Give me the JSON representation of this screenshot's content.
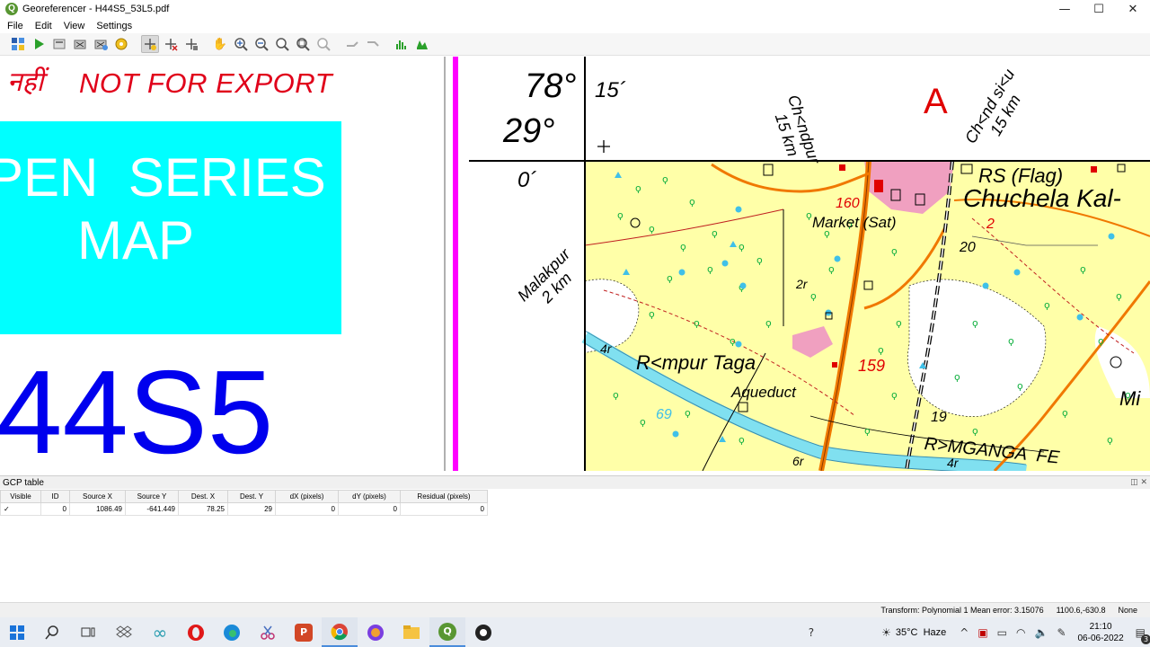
{
  "window": {
    "title": "Georeferencer - H44S5_53L5.pdf",
    "minimize_glyph": "—",
    "maximize_glyph": "☐",
    "close_glyph": "✕"
  },
  "menu": [
    "File",
    "Edit",
    "View",
    "Settings"
  ],
  "toolbar": {
    "icons": [
      "open-raster-icon",
      "start-georeferencing-icon",
      "generate-gdal-script-icon",
      "load-gcp-icon",
      "save-gcp-icon",
      "transformation-settings-icon",
      "add-point-icon",
      "delete-point-icon",
      "move-point-icon",
      "pan-icon",
      "zoom-in-icon",
      "zoom-out-icon",
      "zoom-to-layer-icon",
      "zoom-last-icon",
      "zoom-next-icon",
      "link-georef-to-qgis-icon",
      "link-qgis-to-georef-icon",
      "full-histogram-stretch-icon",
      "local-histogram-stretch-icon"
    ]
  },
  "left_canvas": {
    "hindi_text": "नहीं",
    "not_for_export": "NOT FOR EXPORT",
    "series_line1": "PEN  SERIES",
    "series_line2": "MAP",
    "sheet_number": "44S5",
    "colors": {
      "banner": "#00ffff",
      "red_text": "#e0001a",
      "sheet_blue": "#0000ee"
    }
  },
  "map": {
    "lon_deg": "78°",
    "lat_deg": "29°",
    "lon_min": "15´",
    "lat_min": "0´",
    "sheet_letter": "A",
    "to_chandpur": "Ch<ndpur",
    "chandpur_dist": "15 km",
    "to_chandsiau": "Ch<nd si<u",
    "chandsiau_dist": "15 km",
    "to_malakpur": "Malakpur",
    "malakpur_dist": "2 km",
    "rs_flag": "RS (Flag)",
    "chuchela": "Chuchela Kal-",
    "market": "Market (Sat)",
    "spot_160": "160",
    "spot_159": "159",
    "spot_2": "2",
    "spot_20": "20",
    "spot_19": "19",
    "spot_69": "69",
    "lbl_2r": "2r",
    "lbl_4r": "4r",
    "lbl_4r_b": "4r",
    "lbl_6r": "6r",
    "rampur": "R<mpur Taga",
    "aqueduct": "Aqueduct",
    "mganga": "R>MGANGA  FE",
    "mi": "Mi",
    "colors": {
      "land": "#ffffa8",
      "veg": "#10b040",
      "road": "#f07800",
      "canal": "#80e0f0",
      "village": "#f0a0c0",
      "grid": "#000000",
      "spot_red": "#e00000"
    }
  },
  "gcp": {
    "title": "GCP table",
    "dock_controls": "◫ ✕",
    "columns": [
      "Visible",
      "ID",
      "Source X",
      "Source Y",
      "Dest. X",
      "Dest. Y",
      "dX (pixels)",
      "dY (pixels)",
      "Residual (pixels)"
    ],
    "rows": [
      [
        "✓",
        "0",
        "1086.49",
        "-641.449",
        "78.25",
        "29",
        "0",
        "0",
        "0"
      ]
    ]
  },
  "status": {
    "transform": "Transform: Polynomial 1 Mean error: 3.15076",
    "coords": "1100.6,-630.8",
    "crs": "None"
  },
  "taskbar": {
    "apps": [
      "windows-start-icon",
      "search-icon",
      "task-view-icon",
      "dropbox-icon",
      "infinity-icon",
      "opera-icon",
      "edge-icon",
      "snipping-tool-icon",
      "powerpoint-icon",
      "chrome-icon",
      "firefox-dev-icon",
      "file-explorer-icon",
      "qgis-icon",
      "obs-icon"
    ],
    "weather": "35°C  Haze",
    "time": "21:10",
    "date": "06-06-2022",
    "notifications": "3"
  }
}
